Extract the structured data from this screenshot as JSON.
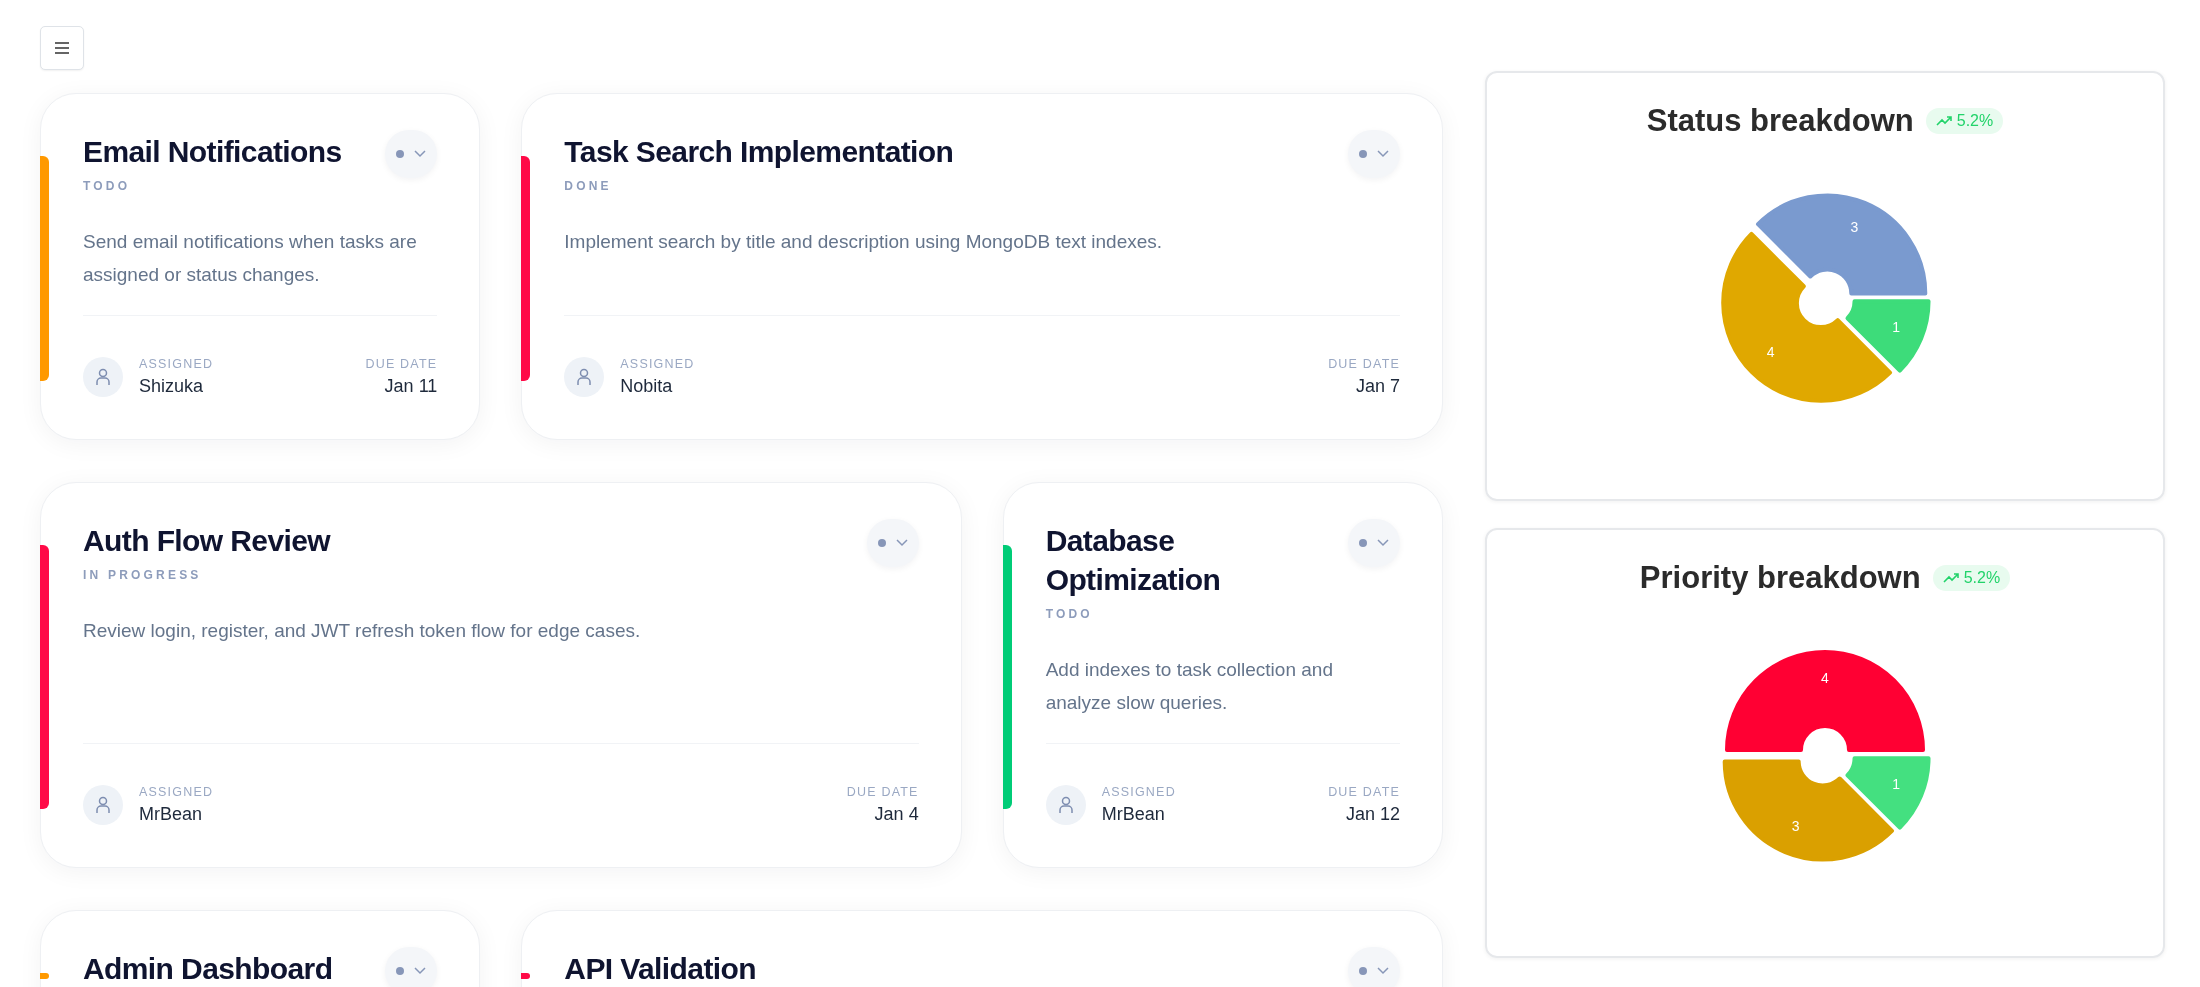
{
  "tasks": [
    {
      "title": "Email Notifications",
      "status": "TODO",
      "description": "Send email notifications when tasks are assigned or status changes.",
      "color": "#ff9900",
      "assigned_label": "ASSIGNED",
      "assignee": "Shizuka",
      "due_label": "DUE DATE",
      "due": "Jan 11"
    },
    {
      "title": "Task Search Implementation",
      "status": "DONE",
      "description": "Implement search by title and description using MongoDB text indexes.",
      "color": "#ff0a47",
      "assigned_label": "ASSIGNED",
      "assignee": "Nobita",
      "due_label": "DUE DATE",
      "due": "Jan 7"
    },
    {
      "title": "Auth Flow Review",
      "status": "IN PROGRESS",
      "description": "Review login, register, and JWT refresh token flow for edge cases.",
      "color": "#ff0a47",
      "assigned_label": "ASSIGNED",
      "assignee": "MrBean",
      "due_label": "DUE DATE",
      "due": "Jan 4"
    },
    {
      "title": "Database Optimization",
      "status": "TODO",
      "description": "Add indexes to task collection and analyze slow queries.",
      "color": "#00cc77",
      "assigned_label": "ASSIGNED",
      "assignee": "MrBean",
      "due_label": "DUE DATE",
      "due": "Jan 12"
    },
    {
      "title": "Admin Dashboard",
      "color": "#ff9900"
    },
    {
      "title": "API Validation",
      "color": "#ff0a47"
    }
  ],
  "charts": [
    {
      "title": "Status breakdown",
      "badge": "5.2%",
      "chart_data": {
        "type": "donut",
        "values": [
          1,
          4,
          3
        ],
        "colors": [
          "#3ddc7a",
          "#e0a800",
          "#7a9acf"
        ],
        "data_labels": true
      }
    },
    {
      "title": "Priority breakdown",
      "badge": "5.2%",
      "chart_data": {
        "type": "donut",
        "values": [
          1,
          3,
          4
        ],
        "colors": [
          "#44e080",
          "#daa000",
          "#ff0033"
        ],
        "data_labels": true
      }
    }
  ]
}
